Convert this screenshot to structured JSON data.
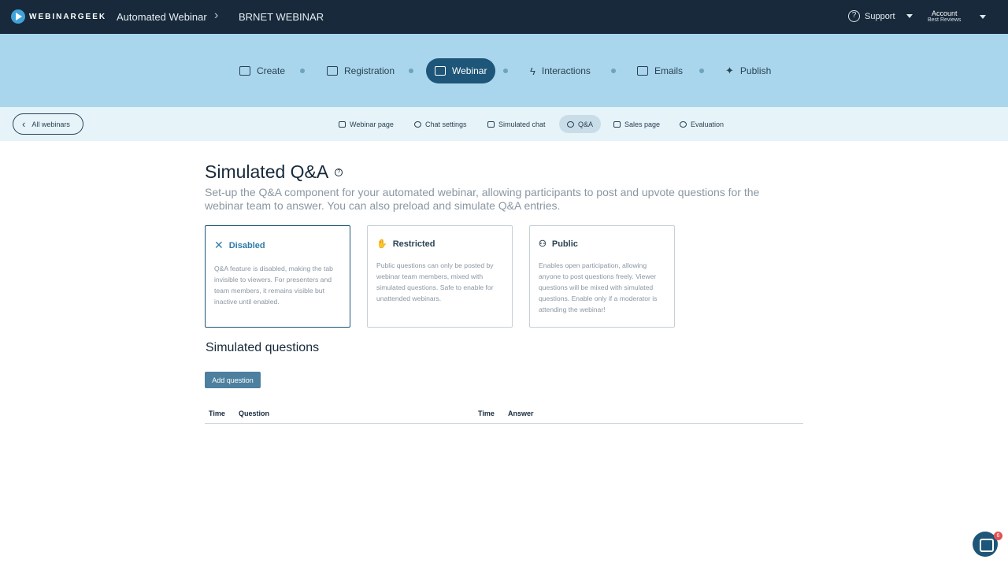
{
  "header": {
    "logo_text": "WEBINARGEEK",
    "breadcrumb": [
      "Automated Webinar",
      "BRNET WEBINAR"
    ],
    "support_label": "Support",
    "account_label": "Account",
    "account_sub": "Best Reviews"
  },
  "steps": [
    {
      "label": "Create",
      "icon": "pencil-icon"
    },
    {
      "label": "Registration",
      "icon": "form-icon"
    },
    {
      "label": "Webinar",
      "icon": "screen-icon",
      "active": true
    },
    {
      "label": "Interactions",
      "icon": "bolt-icon"
    },
    {
      "label": "Emails",
      "icon": "mail-icon"
    },
    {
      "label": "Publish",
      "icon": "sparkle-icon"
    }
  ],
  "subnav": {
    "back_label": "All webinars",
    "tabs": [
      "Webinar page",
      "Chat settings",
      "Simulated chat",
      "Q&A",
      "Sales page",
      "Evaluation"
    ],
    "active_tab": "Q&A"
  },
  "main": {
    "title": "Simulated Q&A",
    "description": "Set-up the Q&A component for your automated webinar, allowing participants to post and upvote questions for the webinar team to answer. You can also preload and simulate Q&A entries.",
    "options": [
      {
        "title": "Disabled",
        "text": "Q&A feature is disabled, making the tab invisible to viewers. For presenters and team members, it remains visible but inactive until enabled."
      },
      {
        "title": "Restricted",
        "text": "Public questions can only be posted by webinar team members, mixed with simulated questions. Safe to enable for unattended webinars."
      },
      {
        "title": "Public",
        "text": "Enables open participation, allowing anyone to post questions freely. Viewer questions will be mixed with simulated questions. Enable only if a moderator is attending the webinar!"
      }
    ],
    "selected_option": "Disabled",
    "simulated_title": "Simulated questions",
    "add_button": "Add question",
    "table_headers": [
      "Time",
      "Question",
      "Time",
      "Answer"
    ]
  },
  "chat_widget": {
    "badge": "6"
  },
  "colors": {
    "topbar": "#17293a",
    "stepbar": "#a9d6ec",
    "accent": "#1d5678"
  }
}
